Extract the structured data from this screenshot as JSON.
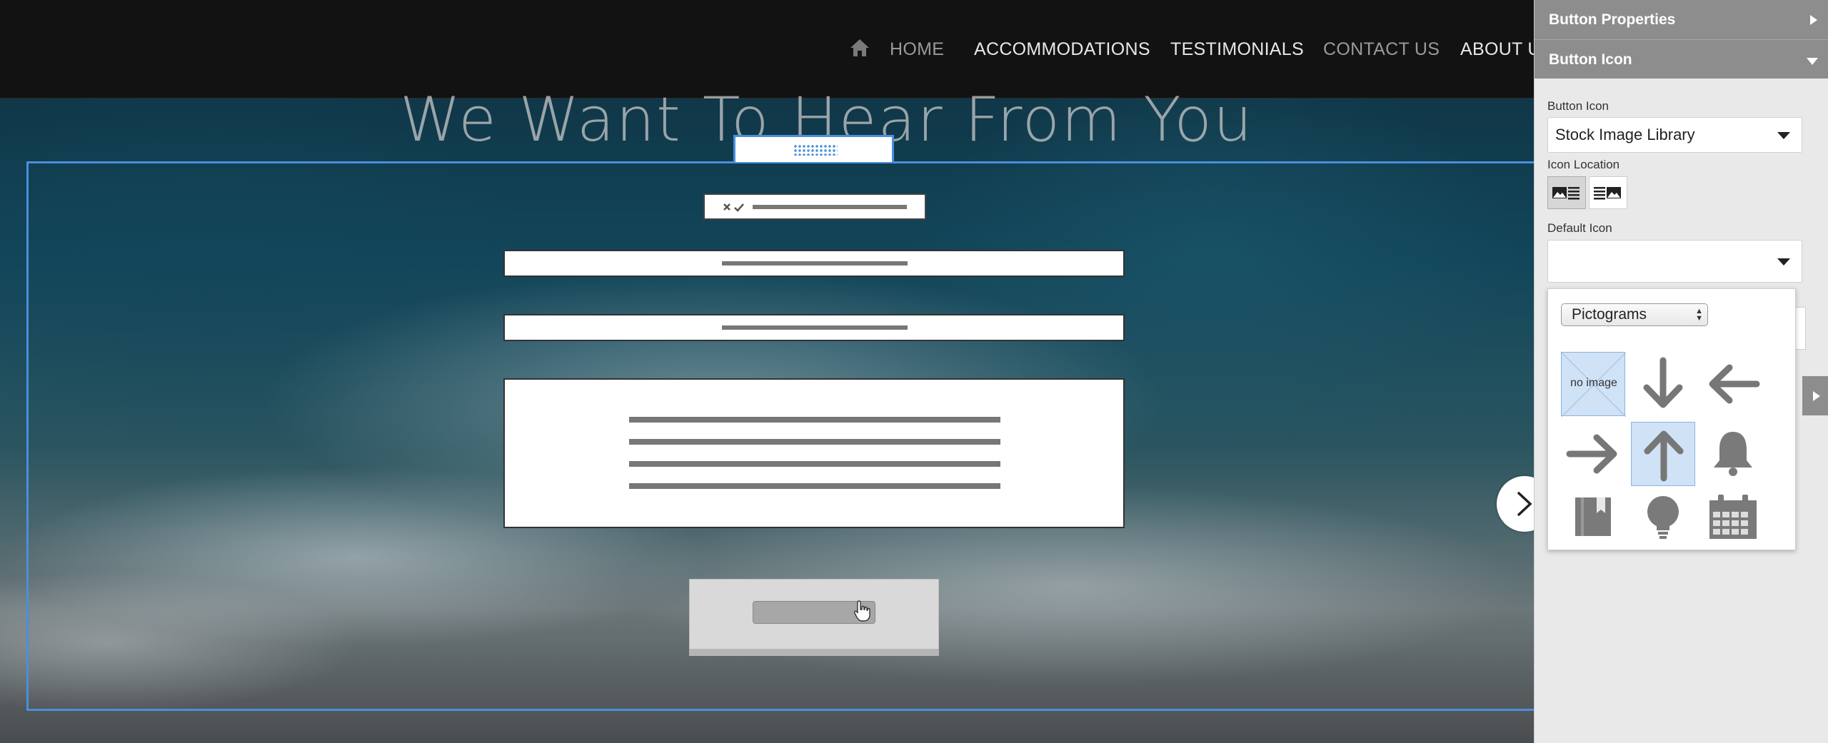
{
  "nav": {
    "items": [
      "HOME",
      "ACCOMMODATIONS",
      "TESTIMONIALS",
      "CONTACT US",
      "ABOUT U"
    ]
  },
  "hero": {
    "title": "We Want To Hear From You"
  },
  "panel": {
    "sections": {
      "button_properties": "Button Properties",
      "button_icon": "Button Icon"
    },
    "button_icon_label": "Button Icon",
    "button_icon_value": "Stock Image Library",
    "icon_location_label": "Icon Location",
    "default_icon_label": "Default Icon",
    "default_icon_value": ""
  },
  "picker": {
    "category": "Pictograms",
    "no_image_label": "no image",
    "icons": [
      "no-image",
      "arrow-down",
      "arrow-left",
      "arrow-right",
      "arrow-up",
      "bell",
      "bookmark",
      "lightbulb",
      "calendar"
    ],
    "selected": "arrow-up"
  },
  "colors": {
    "selection_blue": "#4a8fdd",
    "panel_header": "#8d8d8d",
    "topbar": "#121212"
  }
}
